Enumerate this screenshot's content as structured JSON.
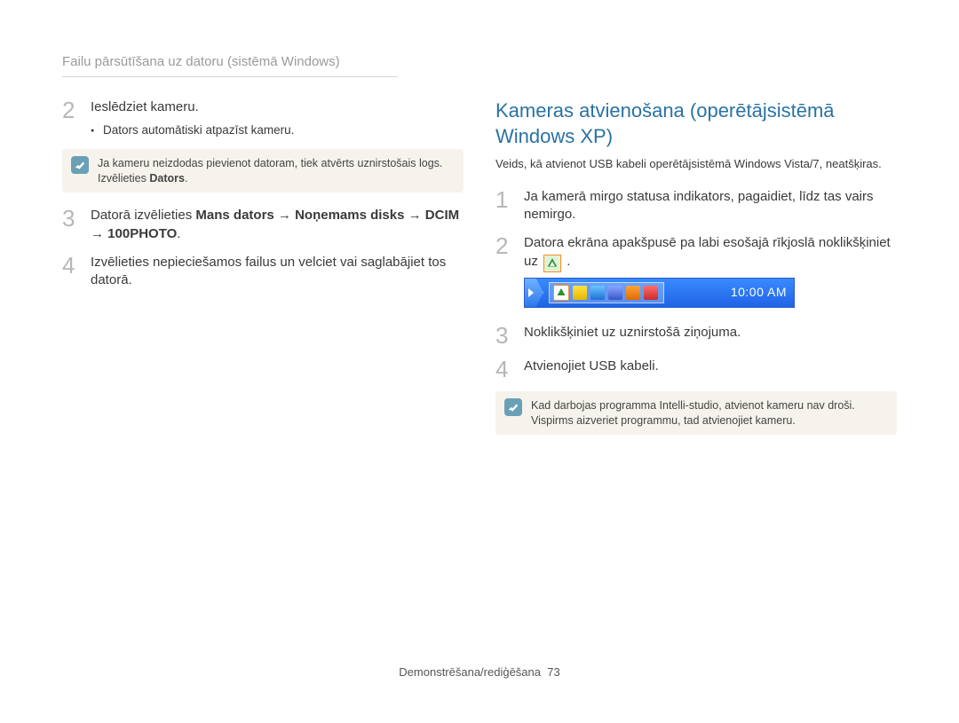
{
  "breadcrumb": "Failu pārsūtīšana uz datoru (sistēmā Windows)",
  "left": {
    "step2": {
      "num": "2",
      "text": "Ieslēdziet kameru.",
      "bullet": "Dators automātiski atpazīst kameru."
    },
    "note1": {
      "line": "Ja kameru neizdodas pievienot datoram, tiek atvērts uznirstošais logs. Izvēlieties ",
      "bold": "Dators",
      "after": "."
    },
    "step3": {
      "num": "3",
      "pre": "Datorā izvēlieties ",
      "bold": "Mans dators → Noņemams disks → DCIM → 100PHOTO",
      "after": "."
    },
    "step4": {
      "num": "4",
      "text": "Izvēlieties nepieciešamos failus un velciet vai saglabājiet tos datorā."
    }
  },
  "right": {
    "title": "Kameras atvienošana (operētājsistēmā Windows XP)",
    "intro": "Veids, kā atvienot USB kabeli operētājsistēmā Windows Vista/7, neatšķiras.",
    "step1": {
      "num": "1",
      "text": "Ja kamerā mirgo statusa indikators, pagaidiet, līdz tas vairs nemirgo."
    },
    "step2": {
      "num": "2",
      "pre": "Datora ekrāna apakšpusē pa labi esošajā rīkjoslā noklikšķiniet uz ",
      "after": "."
    },
    "tray_clock": "10:00 AM",
    "step3": {
      "num": "3",
      "text": "Noklikšķiniet uz uznirstošā ziņojuma."
    },
    "step4": {
      "num": "4",
      "text": "Atvienojiet USB kabeli."
    },
    "note2": {
      "text": "Kad darbojas programma Intelli-studio, atvienot kameru nav droši. Vispirms aizveriet programmu, tad atvienojiet kameru."
    }
  },
  "footer": {
    "label": "Demonstrēšana/rediģēšana",
    "page": "73"
  }
}
